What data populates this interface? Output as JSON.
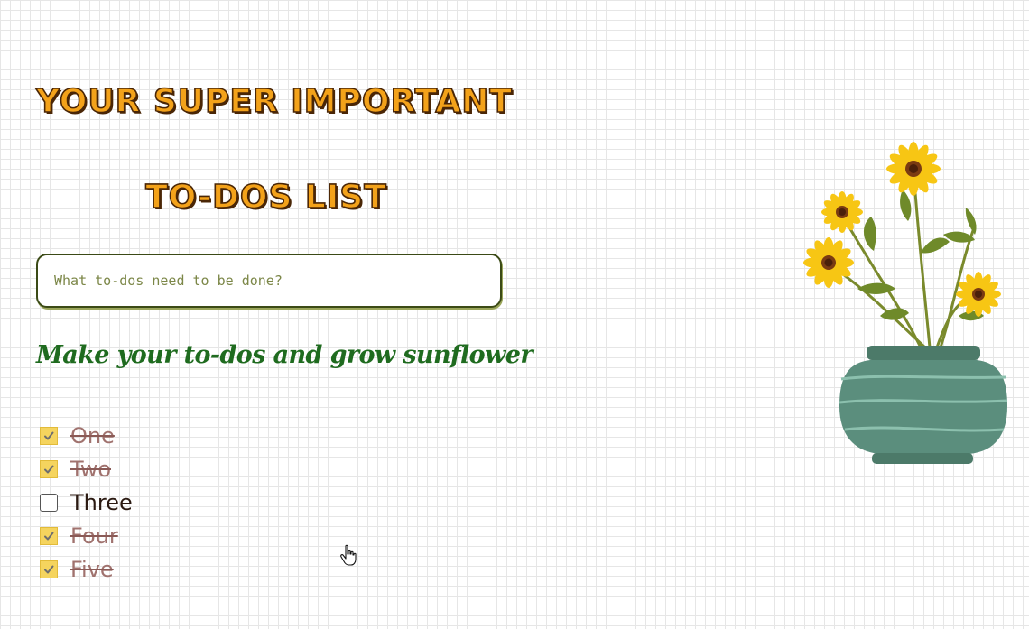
{
  "header": {
    "title_line1": "YOUR SUPER IMPORTANT",
    "title_line2": "TO-DOS LIST"
  },
  "input": {
    "placeholder": "What to-dos need to be done?",
    "value": ""
  },
  "subtitle": "Make your to-dos and grow sunflower",
  "todos": [
    {
      "label": "One",
      "done": true
    },
    {
      "label": "Two",
      "done": true
    },
    {
      "label": "Three",
      "done": false
    },
    {
      "label": "Four",
      "done": true
    },
    {
      "label": "Five",
      "done": true
    }
  ],
  "colors": {
    "title_fill": "#f3a21a",
    "title_outline": "#4a2606",
    "subtitle": "#1f6b1f",
    "checkbox_checked": "#f5d45e",
    "done_text": "#a0726e",
    "vase": "#5b8e7d",
    "petal": "#f7c614"
  },
  "illustration": {
    "icon": "sunflower-vase-illustration",
    "sunflower_count": 4
  }
}
